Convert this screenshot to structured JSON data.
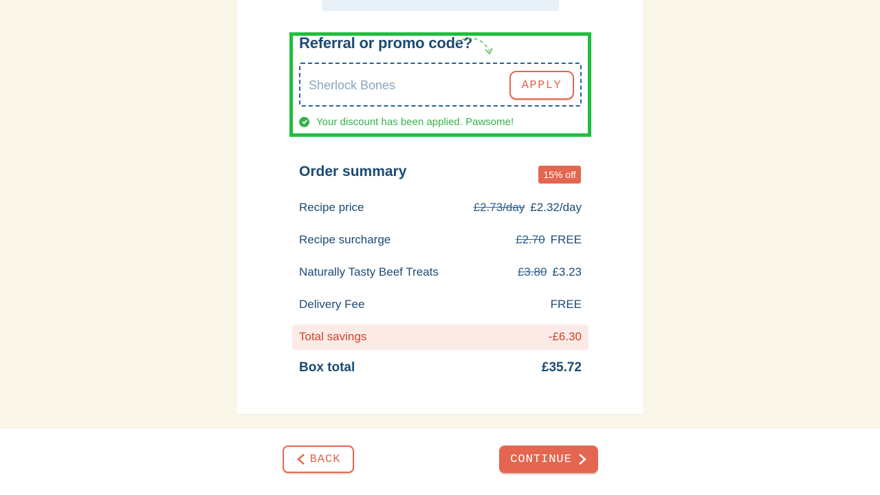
{
  "promo": {
    "title": "Referral or promo code?",
    "placeholder": "Sherlock Bones",
    "apply_label": "APPLY",
    "success_message": "Your discount has been applied. Pawsome!"
  },
  "summary": {
    "title": "Order summary",
    "badge": "15% off",
    "rows": [
      {
        "label": "Recipe price",
        "old": "£2.73/day",
        "new": "£2.32/day"
      },
      {
        "label": "Recipe surcharge",
        "old": "£2.70",
        "new": "FREE"
      },
      {
        "label": "Naturally Tasty Beef Treats",
        "old": "£3.80",
        "new": "£3.23"
      },
      {
        "label": "Delivery Fee",
        "new": "FREE"
      }
    ],
    "savings": {
      "label": "Total savings",
      "value": "-£6.30"
    },
    "total": {
      "label": "Box total",
      "value": "£35.72"
    }
  },
  "footer": {
    "back_label": "BACK",
    "continue_label": "CONTINUE"
  },
  "colors": {
    "accent": "#e46650",
    "navy": "#1c4a73",
    "success": "#34b34a",
    "highlight": "#1fbf3c",
    "background": "#faf7e8"
  },
  "icons": [
    "check-circle-icon",
    "curved-arrow-icon",
    "chevron-left-icon",
    "chevron-right-icon"
  ]
}
